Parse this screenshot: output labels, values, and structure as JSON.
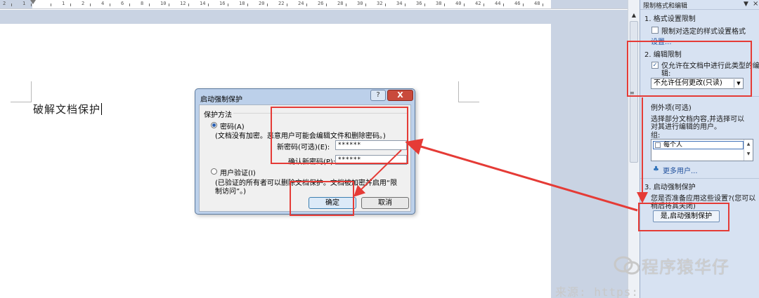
{
  "ruler": {
    "numbers": [
      "2",
      "1",
      "",
      "1",
      "2",
      "4",
      "6",
      "8",
      "10",
      "12",
      "14",
      "16",
      "18",
      "20",
      "22",
      "24",
      "26",
      "28",
      "30",
      "32",
      "34",
      "36",
      "38",
      "40",
      "42",
      "44",
      "46",
      "48"
    ]
  },
  "document": {
    "text": "破解文档保护"
  },
  "dialog": {
    "title": "启动强制保护",
    "help_label": "?",
    "close_label": "X",
    "group_label": "保护方法",
    "password_option": "密码(A)",
    "password_note": "(文档没有加密。恶意用户可能会编辑文件和删除密码。)",
    "new_password_label": "新密码(可选)(E):",
    "new_password_value": "******",
    "confirm_password_label": "确认新密码(P):",
    "confirm_password_value": "******",
    "user_auth_option": "用户验证(I)",
    "user_auth_note_line1": "(已验证的所有者可以删除文档保护。文档被加密并启用“限",
    "user_auth_note_line2": "制访问”。)",
    "ok_label": "确定",
    "cancel_label": "取消"
  },
  "task_pane": {
    "title": "限制格式和编辑",
    "dropdown_icon": "▼",
    "close_icon": "×",
    "section1_title": "1. 格式设置限制",
    "section1_checkbox": "限制对选定的样式设置格式",
    "section1_link": "设置...",
    "section2_title": "2. 编辑限制",
    "section2_checkbox_line1": "仅允许在文档中进行此类型的编",
    "section2_checkbox_line2": "辑:",
    "section2_select": "不允许任何更改(只读)",
    "exceptions_title": "例外项(可选)",
    "exceptions_desc_line1": "选择部分文档内容,并选择可以",
    "exceptions_desc_line2": "对其进行编辑的用户。",
    "group_label": "组:",
    "everyone_item": "每个人",
    "more_users_link": "更多用户...",
    "section3_title": "3. 启动强制保护",
    "section3_desc_line1": "您是否准备应用这些设置?(您可以",
    "section3_desc_line2": "稍后将其关闭)",
    "start_button": "是,启动强制保护"
  },
  "watermark": {
    "brand": "程序猿华仔",
    "source": "来源: https:"
  },
  "colors": {
    "annotation_red": "#e53b36",
    "pane_bg": "#d7e2f2",
    "dialog_frame": "#bcd0ea"
  }
}
